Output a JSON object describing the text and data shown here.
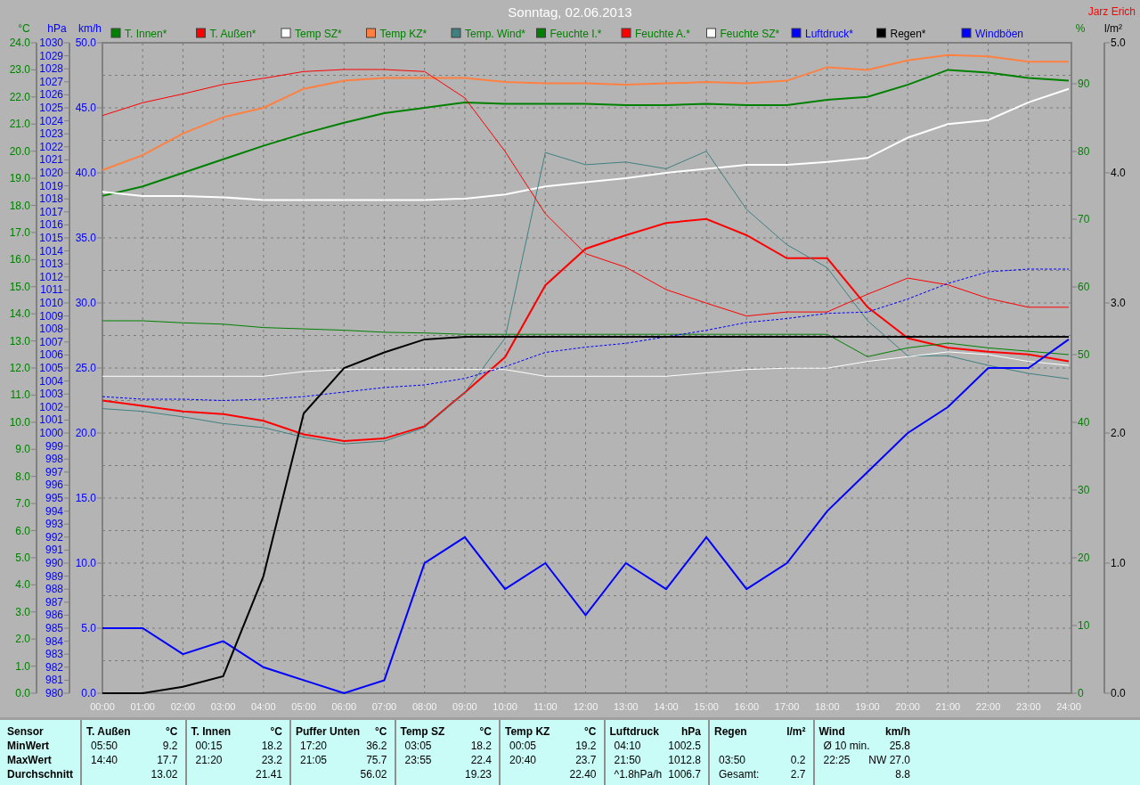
{
  "header": {
    "title": "Sonntag, 02.06.2013",
    "author": "Jarz Erich"
  },
  "charts": [
    {
      "chart_data": {
        "type": "line",
        "grid": true,
        "legend": "top",
        "categories": [
          "00:00",
          "01:00",
          "02:00",
          "03:00",
          "04:00",
          "05:00",
          "06:00",
          "07:00",
          "08:00",
          "09:00",
          "10:00",
          "11:00",
          "12:00",
          "13:00",
          "14:00",
          "15:00",
          "16:00",
          "17:00",
          "18:00",
          "19:00",
          "20:00",
          "21:00",
          "22:00",
          "23:00",
          "24:00"
        ],
        "ylabel": "°C",
        "ylim": [
          0,
          24
        ],
        "yticks": [
          {
            "value": 24,
            "label": "24.0"
          },
          {
            "value": 23,
            "label": "23.0"
          },
          {
            "value": 22,
            "label": "22.0"
          },
          {
            "value": 21,
            "label": "21.0"
          },
          {
            "value": 20,
            "label": "20.0"
          },
          {
            "value": 19,
            "label": "19.0"
          },
          {
            "value": 18,
            "label": "18.0"
          },
          {
            "value": 17,
            "label": "17.0"
          },
          {
            "value": 16,
            "label": "16.0"
          },
          {
            "value": 15,
            "label": "15.0"
          },
          {
            "value": 14,
            "label": "14.0"
          },
          {
            "value": 13,
            "label": "13.0"
          },
          {
            "value": 12,
            "label": "12.0"
          },
          {
            "value": 11,
            "label": "11.0"
          },
          {
            "value": 10,
            "label": "10.0"
          },
          {
            "value": 9,
            "label": "9.0"
          },
          {
            "value": 8,
            "label": "8.0"
          },
          {
            "value": 7,
            "label": "7.0"
          },
          {
            "value": 6,
            "label": "6.0"
          },
          {
            "value": 5,
            "label": "5.0"
          },
          {
            "value": 4,
            "label": "4.0"
          },
          {
            "value": 3,
            "label": "3.0"
          },
          {
            "value": 2,
            "label": "2.0"
          },
          {
            "value": 1,
            "label": "1.0"
          },
          {
            "value": 0,
            "label": "0.0"
          }
        ],
        "y2label": "%",
        "y2lim": [
          0,
          96.05
        ],
        "y2ticks": [
          {
            "value": 90,
            "label": "90"
          },
          {
            "value": 80,
            "label": "80"
          },
          {
            "value": 70,
            "label": "70"
          },
          {
            "value": 60,
            "label": "60"
          },
          {
            "value": 50,
            "label": "50"
          },
          {
            "value": 40,
            "label": "40"
          },
          {
            "value": 30,
            "label": "30"
          },
          {
            "value": 20,
            "label": "20"
          },
          {
            "value": 10,
            "label": "10"
          },
          {
            "value": 0,
            "label": "0"
          }
        ],
        "y3label": "km/h",
        "y3lim": [
          0,
          50
        ],
        "y3ticks": [
          {
            "value": 50,
            "label": "50.0"
          },
          {
            "value": 45,
            "label": "45.0"
          },
          {
            "value": 40,
            "label": "40.0"
          },
          {
            "value": 35,
            "label": "35.0"
          },
          {
            "value": 30,
            "label": "30.0"
          },
          {
            "value": 25,
            "label": "25.0"
          },
          {
            "value": 20,
            "label": "20.0"
          },
          {
            "value": 15,
            "label": "15.0"
          },
          {
            "value": 10,
            "label": "10.0"
          },
          {
            "value": 5,
            "label": "5.0"
          },
          {
            "value": 0,
            "label": "0.0"
          }
        ],
        "series": [
          {
            "name": "T. Innen*",
            "color": "#008000",
            "values": [
              18.35,
              18.7,
              19.2,
              19.7,
              20.2,
              20.65,
              21.05,
              21.4,
              21.6,
              21.8,
              21.75,
              21.75,
              21.75,
              21.7,
              21.7,
              21.75,
              21.7,
              21.7,
              21.9,
              22.0,
              22.45,
              23.0,
              22.9,
              22.7,
              22.6
            ]
          },
          {
            "name": "T. Außen*",
            "color": "#ff0000",
            "values": [
              10.8,
              10.6,
              10.4,
              10.3,
              10.05,
              9.55,
              9.3,
              9.4,
              9.85,
              11.1,
              12.4,
              15.05,
              16.4,
              16.9,
              17.35,
              17.5,
              16.9,
              16.05,
              16.05,
              14.25,
              13.1,
              12.75,
              12.6,
              12.5,
              12.25
            ]
          },
          {
            "name": "Temp SZ*",
            "color": "#ffffff",
            "values": [
              18.5,
              18.35,
              18.35,
              18.3,
              18.2,
              18.2,
              18.2,
              18.2,
              18.2,
              18.25,
              18.4,
              18.7,
              18.85,
              19.0,
              19.2,
              19.35,
              19.5,
              19.5,
              19.6,
              19.75,
              20.5,
              21.0,
              21.15,
              21.8,
              22.3
            ]
          },
          {
            "name": "Temp KZ*",
            "color": "#ff8040",
            "values": [
              19.3,
              19.85,
              20.65,
              21.25,
              21.6,
              22.3,
              22.6,
              22.7,
              22.7,
              22.7,
              22.55,
              22.5,
              22.5,
              22.45,
              22.5,
              22.55,
              22.5,
              22.6,
              23.1,
              23.0,
              23.35,
              23.55,
              23.5,
              23.3,
              23.3
            ]
          },
          {
            "name": "Temp. Wind*",
            "color": "#408080",
            "values": [
              10.5,
              10.4,
              10.2,
              9.95,
              9.8,
              9.45,
              9.2,
              9.3,
              9.8,
              11.1,
              13.1,
              19.95,
              19.5,
              19.6,
              19.35,
              20.0,
              17.85,
              16.55,
              15.7,
              13.75,
              12.45,
              12.45,
              12.1,
              11.8,
              11.6
            ]
          },
          {
            "name": "Feuchte I.*",
            "color": "#008000",
            "axis": "y2",
            "values": [
              55,
              55,
              54.7,
              54.5,
              54,
              53.8,
              53.6,
              53.3,
              53.2,
              53,
              53,
              53,
              53,
              53,
              53,
              53,
              53,
              53,
              53,
              49.7,
              51,
              51.7,
              51,
              50.5,
              50
            ]
          },
          {
            "name": "Feuchte A.*",
            "color": "#ff0000",
            "axis": "y2",
            "values": [
              85.3,
              87.2,
              88.5,
              89.9,
              90.8,
              91.8,
              92.1,
              92.1,
              91.8,
              87.9,
              80,
              70.8,
              64.9,
              62.9,
              59.6,
              57.6,
              55.7,
              56.3,
              56.3,
              58.9,
              61.3,
              60.3,
              58.3,
              57,
              57
            ]
          },
          {
            "name": "Feuchte SZ*",
            "color": "#ffffff",
            "axis": "y2",
            "values": [
              46.8,
              46.8,
              46.8,
              46.8,
              46.8,
              47.5,
              47.8,
              47.8,
              47.8,
              47.8,
              47.8,
              46.8,
              46.8,
              46.8,
              46.8,
              47.3,
              47.8,
              48,
              48,
              49,
              49.7,
              50.4,
              50,
              49,
              48.4
            ]
          },
          {
            "name": "Windböen",
            "color": "#0000ff",
            "axis": "y3",
            "values": [
              5,
              5,
              3,
              4,
              2,
              1,
              0,
              1,
              10,
              12,
              8,
              10,
              6,
              10,
              8,
              12,
              8,
              10,
              14,
              17,
              20,
              22,
              25,
              25,
              27.2
            ]
          }
        ]
      }
    },
    {
      "chart_data": {
        "type": "line",
        "legend": "top",
        "categories": [
          null,
          null,
          null,
          null,
          null,
          null,
          null,
          null,
          null,
          null,
          null,
          null,
          null,
          null,
          null,
          null,
          null,
          null,
          null,
          null,
          null,
          null,
          null,
          null,
          null
        ],
        "ylabel": "hPa",
        "ylim": [
          980,
          1030
        ],
        "yticks": [
          {
            "value": 1030,
            "label": "1030"
          },
          {
            "value": 1029,
            "label": "1029"
          },
          {
            "value": 1028,
            "label": "1028"
          },
          {
            "value": 1027,
            "label": "1027"
          },
          {
            "value": 1026,
            "label": "1026"
          },
          {
            "value": 1025,
            "label": "1025"
          },
          {
            "value": 1024,
            "label": "1024"
          },
          {
            "value": 1023,
            "label": "1023"
          },
          {
            "value": 1022,
            "label": "1022"
          },
          {
            "value": 1021,
            "label": "1021"
          },
          {
            "value": 1020,
            "label": "1020"
          },
          {
            "value": 1019,
            "label": "1019"
          },
          {
            "value": 1018,
            "label": "1018"
          },
          {
            "value": 1017,
            "label": "1017"
          },
          {
            "value": 1016,
            "label": "1016"
          },
          {
            "value": 1015,
            "label": "1015"
          },
          {
            "value": 1014,
            "label": "1014"
          },
          {
            "value": 1013,
            "label": "1013"
          },
          {
            "value": 1012,
            "label": "1012"
          },
          {
            "value": 1011,
            "label": "1011"
          },
          {
            "value": 1010,
            "label": "1010"
          },
          {
            "value": 1009,
            "label": "1009"
          },
          {
            "value": 1008,
            "label": "1008"
          },
          {
            "value": 1007,
            "label": "1007"
          },
          {
            "value": 1006,
            "label": "1006"
          },
          {
            "value": 1005,
            "label": "1005"
          },
          {
            "value": 1004,
            "label": "1004"
          },
          {
            "value": 1003,
            "label": "1003"
          },
          {
            "value": 1002,
            "label": "1002"
          },
          {
            "value": 1001,
            "label": "1001"
          },
          {
            "value": 1000,
            "label": "1000"
          },
          {
            "value": 999,
            "label": "999"
          },
          {
            "value": 998,
            "label": "998"
          },
          {
            "value": 997,
            "label": "997"
          },
          {
            "value": 996,
            "label": "996"
          },
          {
            "value": 995,
            "label": "995"
          },
          {
            "value": 994,
            "label": "994"
          },
          {
            "value": 993,
            "label": "993"
          },
          {
            "value": 992,
            "label": "992"
          },
          {
            "value": 991,
            "label": "991"
          },
          {
            "value": 990,
            "label": "990"
          },
          {
            "value": 989,
            "label": "989"
          },
          {
            "value": 988,
            "label": "988"
          },
          {
            "value": 987,
            "label": "987"
          },
          {
            "value": 986,
            "label": "986"
          },
          {
            "value": 985,
            "label": "985"
          },
          {
            "value": 984,
            "label": "984"
          },
          {
            "value": 983,
            "label": "983"
          },
          {
            "value": 982,
            "label": "982"
          },
          {
            "value": 981,
            "label": "981"
          },
          {
            "value": 980,
            "label": "980"
          }
        ],
        "y2label": "l/m²",
        "y2lim": [
          0,
          5
        ],
        "y2ticks": [
          {
            "value": 5,
            "label": "5.0"
          },
          {
            "value": 4,
            "label": "4.0"
          },
          {
            "value": 3,
            "label": "3.0"
          },
          {
            "value": 2,
            "label": "2.0"
          },
          {
            "value": 1,
            "label": "1.0"
          },
          {
            "value": 0,
            "label": "0.0"
          }
        ],
        "series": [
          {
            "name": "Luftdruck*",
            "color": "#0000ff",
            "line_style": "dashed",
            "values": [
              1002.8,
              1002.6,
              1002.6,
              1002.5,
              1002.6,
              1002.8,
              1003.15,
              1003.5,
              1003.7,
              1004.2,
              1005.1,
              1006.2,
              1006.6,
              1006.9,
              1007.4,
              1007.9,
              1008.5,
              1008.8,
              1009.2,
              1009.3,
              1010.3,
              1011.5,
              1012.4,
              1012.6,
              1012.6
            ]
          },
          {
            "name": "Regen*",
            "color": "#000000",
            "axis": "y2",
            "values": [
              0,
              0,
              0.05,
              0.13,
              0.9,
              2.15,
              2.5,
              2.62,
              2.72,
              2.74,
              2.74,
              2.74,
              2.74,
              2.74,
              2.74,
              2.74,
              2.74,
              2.74,
              2.74,
              2.74,
              2.74,
              2.74,
              2.74,
              2.74,
              2.74
            ]
          }
        ]
      }
    }
  ],
  "table": {
    "label_header": "Sensor",
    "row_labels": [
      "MinWert",
      "MaxWert",
      "Durchschnitt"
    ],
    "sections": [
      {
        "name": "T. Außen",
        "unit": "°C",
        "rows": [
          {
            "time": "05:50",
            "value": "9.2"
          },
          {
            "time": "14:40",
            "value": "17.7"
          },
          {
            "value": "13.02"
          }
        ]
      },
      {
        "name": "T. Innen",
        "unit": "°C",
        "rows": [
          {
            "time": "00:15",
            "value": "18.2"
          },
          {
            "time": "21:20",
            "value": "23.2"
          },
          {
            "value": "21.41"
          }
        ]
      },
      {
        "name": "Puffer Unten",
        "unit": "°C",
        "rows": [
          {
            "time": "17:20",
            "value": "36.2"
          },
          {
            "time": "21:05",
            "value": "75.7"
          },
          {
            "value": "56.02"
          }
        ]
      },
      {
        "name": "Temp SZ",
        "unit": "°C",
        "rows": [
          {
            "time": "03:05",
            "value": "18.2"
          },
          {
            "time": "23:55",
            "value": "22.4"
          },
          {
            "value": "19.23"
          }
        ]
      },
      {
        "name": "Temp KZ",
        "unit": "°C",
        "rows": [
          {
            "time": "00:05",
            "value": "19.2"
          },
          {
            "time": "20:40",
            "value": "23.7"
          },
          {
            "value": "22.40"
          }
        ]
      },
      {
        "name": "Luftdruck",
        "unit": "hPa",
        "rows": [
          {
            "time": "04:10",
            "value": "1002.5"
          },
          {
            "time": "21:50",
            "value": "1012.8"
          },
          {
            "time": "^1.8hPa/h",
            "value": "1006.7"
          }
        ]
      },
      {
        "name": "Regen",
        "unit": "l/m²",
        "rows": [
          {},
          {
            "time": "03:50",
            "value": "0.2"
          },
          {
            "time": "Gesamt:",
            "value": "2.7"
          }
        ]
      },
      {
        "name": "Wind",
        "unit": "km/h",
        "rows": [
          {
            "time": "Ø 10 min.",
            "value": "25.8"
          },
          {
            "time": "22:25",
            "value": "NW 27.0"
          },
          {
            "value": "8.8"
          }
        ]
      }
    ]
  }
}
